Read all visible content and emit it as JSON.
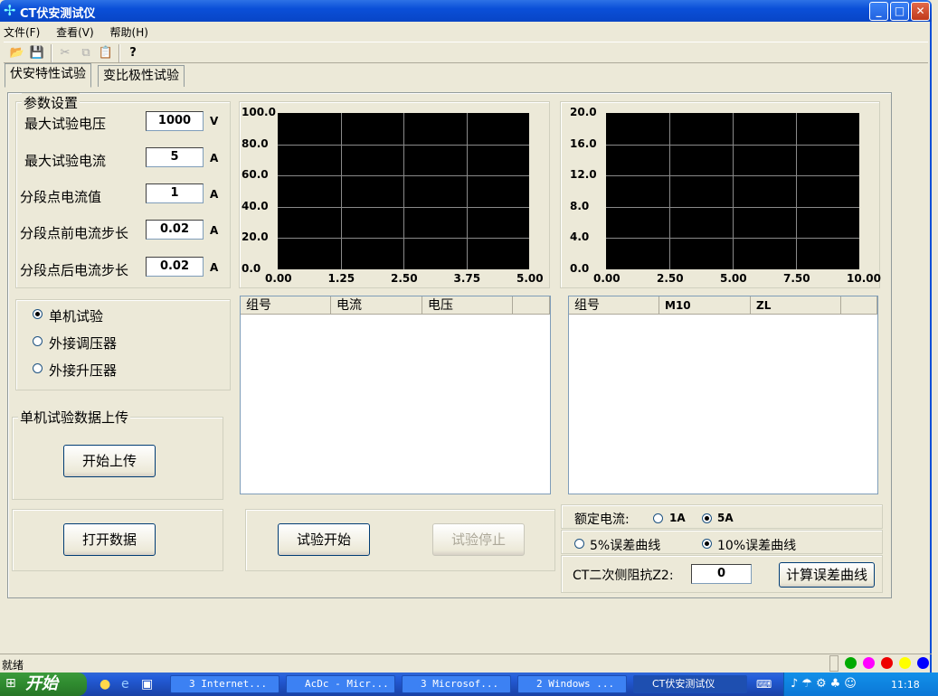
{
  "window": {
    "title": "CT伏安测试仪"
  },
  "menu": [
    "文件(F)",
    "查看(V)",
    "帮助(H)"
  ],
  "toolbar": {
    "icons": [
      "open-folder-icon",
      "save-icon",
      "cut-icon",
      "copy-icon",
      "paste-icon",
      "help-icon"
    ]
  },
  "tabs": [
    "伏安特性试验",
    "变比极性试验"
  ],
  "params": {
    "title": "参数设置",
    "rows": [
      {
        "label": "最大试验电压",
        "value": "1000",
        "unit": "V"
      },
      {
        "label": "最大试验电流",
        "value": "5",
        "unit": "A"
      },
      {
        "label": "分段点电流值",
        "value": "1",
        "unit": "A"
      },
      {
        "label": "分段点前电流步长",
        "value": "0.02",
        "unit": "A"
      },
      {
        "label": "分段点后电流步长",
        "value": "0.02",
        "unit": "A"
      }
    ]
  },
  "mode": {
    "options": [
      "单机试验",
      "外接调压器",
      "外接升压器"
    ],
    "selected": 0
  },
  "upload": {
    "title": "单机试验数据上传",
    "button": "开始上传"
  },
  "buttons": {
    "open_data": "打开数据",
    "start_test": "试验开始",
    "stop_test": "试验停止",
    "calc_curve": "计算误差曲线"
  },
  "chart_data": [
    {
      "type": "line",
      "xlim": [
        0,
        5
      ],
      "ylim": [
        0,
        100
      ],
      "grid": true,
      "x_ticks": [
        "0.00",
        "1.25",
        "2.50",
        "3.75",
        "5.00"
      ],
      "y_ticks": [
        "0.0",
        "20.0",
        "40.0",
        "60.0",
        "80.0",
        "100.0"
      ],
      "series": []
    },
    {
      "type": "line",
      "xlim": [
        0,
        10
      ],
      "ylim": [
        0,
        20
      ],
      "grid": true,
      "x_ticks": [
        "0.00",
        "2.50",
        "5.00",
        "7.50",
        "10.00"
      ],
      "y_ticks": [
        "0.0",
        "4.0",
        "8.0",
        "12.0",
        "16.0",
        "20.0"
      ],
      "series": []
    }
  ],
  "table_left": {
    "columns": [
      "组号",
      "电流",
      "电压",
      ""
    ],
    "rows": []
  },
  "table_right": {
    "columns": [
      "组号",
      "M10",
      "ZL",
      ""
    ],
    "rows": []
  },
  "rated_current": {
    "label": "额定电流:",
    "options": [
      "1A",
      "5A"
    ],
    "selected": 1
  },
  "error_curve": {
    "options": [
      "5%误差曲线",
      "10%误差曲线"
    ],
    "selected": 1
  },
  "impedance": {
    "label": "CT二次侧阻抗Z2:",
    "value": "0"
  },
  "status": {
    "text": "就绪",
    "indicator_colors": [
      "#0a0",
      "#f0f",
      "#e00",
      "#ff0",
      "#00f"
    ]
  },
  "taskbar": {
    "start": "开始",
    "tasks": [
      "3 Internet...",
      "AcDc - Micr...",
      "3 Microsof...",
      "2 Windows ...",
      "CT伏安测试仪"
    ],
    "active": 4,
    "clock": "11:18"
  }
}
